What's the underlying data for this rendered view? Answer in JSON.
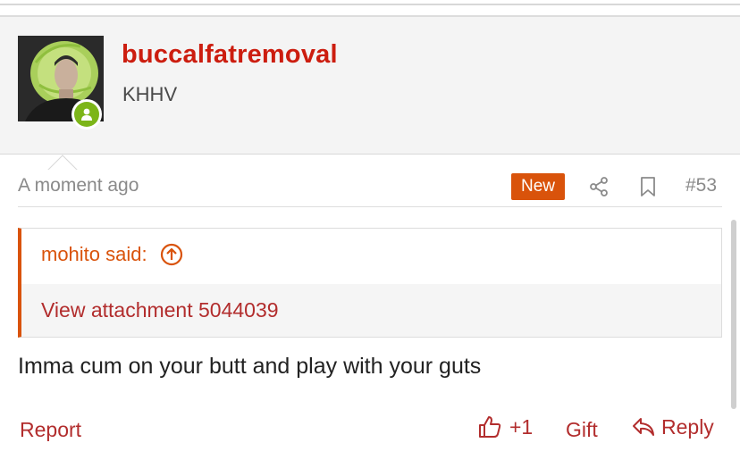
{
  "post": {
    "username": "buccalfatremoval",
    "user_title": "KHHV",
    "timestamp": "A moment ago",
    "new_badge": "New",
    "post_number": "#53",
    "quote": {
      "author_label": "mohito said:",
      "attachment_text": "View attachment 5044039"
    },
    "message": "Imma cum on your butt and play with your guts",
    "actions": {
      "report": "Report",
      "like_count": "+1",
      "gift": "Gift",
      "reply": "Reply"
    }
  },
  "icons": {
    "avatar": "user-avatar-image",
    "online": "online-status-icon",
    "share": "share-icon",
    "bookmark": "bookmark-icon",
    "quote_jump": "arrow-up-circle-icon",
    "like": "thumbs-up-icon",
    "reply": "reply-arrow-icon"
  },
  "colors": {
    "username": "#cc1d0f",
    "accent": "#d9530b",
    "link": "#b22d2d",
    "online": "#7cb518"
  }
}
